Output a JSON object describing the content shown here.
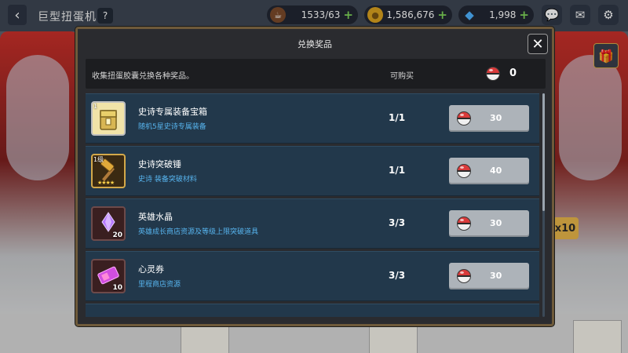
{
  "hud": {
    "title": "巨型扭蛋机",
    "help": "?",
    "resources": [
      {
        "icon": "coffee-icon",
        "value": "1533/63",
        "plus": "+"
      },
      {
        "icon": "gold-coin-icon",
        "value": "1,586,676",
        "plus": "+"
      },
      {
        "icon": "gem-icon",
        "value": "1,998",
        "plus": "+"
      }
    ]
  },
  "side": {
    "multiplier": "x10"
  },
  "modal": {
    "title": "兑换奖品",
    "close": "✕",
    "description": "收集扭蛋胶囊兑换各种奖品。",
    "can_buy_label": "可购买",
    "capsule_count": "0"
  },
  "items": [
    {
      "name": "史诗专属装备宝箱",
      "desc": "随机5星史诗专属装备",
      "stock": "1/1",
      "price": "30",
      "level": "1",
      "count": "",
      "stars": "",
      "icon": "chest-icon",
      "bg": "#f1e3a8"
    },
    {
      "name": "史诗突破锤",
      "desc": "史诗 装备突破材料",
      "stock": "1/1",
      "price": "40",
      "level": "1级",
      "count": "",
      "stars": "★★★★",
      "icon": "hammer-icon",
      "bg": "#3b2a12"
    },
    {
      "name": "英雄水晶",
      "desc": "英雄成长商店资源及等级上限突破道具",
      "stock": "3/3",
      "price": "30",
      "level": "",
      "count": "20",
      "stars": "",
      "icon": "crystal-icon",
      "bg": "#3a1f20"
    },
    {
      "name": "心灵券",
      "desc": "里程商店资源",
      "stock": "3/3",
      "price": "30",
      "level": "",
      "count": "10",
      "stars": "",
      "icon": "ticket-icon",
      "bg": "#3a1f20"
    }
  ]
}
